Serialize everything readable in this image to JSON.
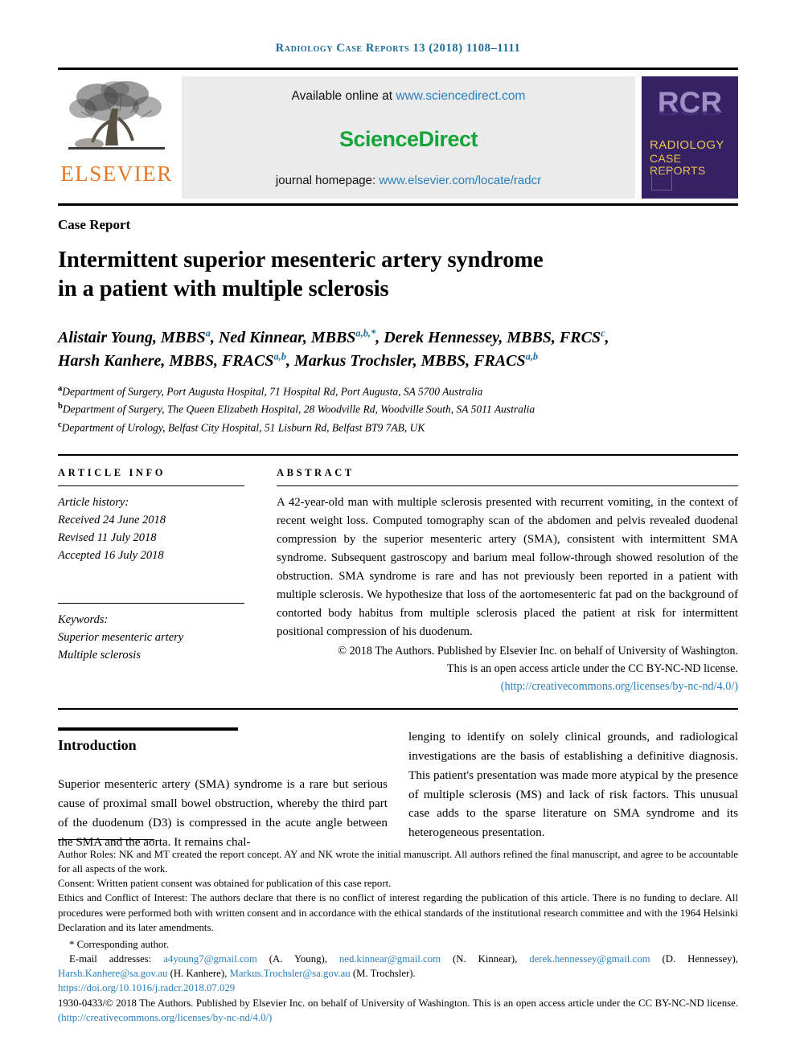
{
  "running_head": {
    "journal": "Radiology Case Reports",
    "volume_year_pages": "13 (2018) 1108–1111"
  },
  "masthead": {
    "elsevier_wordmark": "ELSEVIER",
    "available_online_prefix": "Available online at ",
    "sciencedirect_url": "www.sciencedirect.com",
    "sciencedirect_logo": "ScienceDirect",
    "journal_homepage_prefix": "journal homepage: ",
    "journal_homepage_url": "www.elsevier.com/locate/radcr",
    "cover": {
      "acronym": "RCR",
      "title_line1": "RADIOLOGY",
      "title_line2": "CASE",
      "title_line3": "REPORTS"
    }
  },
  "article": {
    "type_label": "Case Report",
    "title_line1": "Intermittent superior mesenteric artery syndrome",
    "title_line2": "in a patient with multiple sclerosis",
    "authors_line1_a": "Alistair Young, MBBS",
    "authors_line1_a_sup": "a",
    "authors_line1_b": ", Ned Kinnear, MBBS",
    "authors_line1_b_sup": "a,b,*",
    "authors_line1_c": ", Derek Hennessey, MBBS, FRCS",
    "authors_line1_c_sup": "c",
    "authors_line1_tail": ",",
    "authors_line2_a": "Harsh Kanhere, MBBS, FRACS",
    "authors_line2_a_sup": "a,b",
    "authors_line2_b": ", Markus Trochsler, MBBS, FRACS",
    "authors_line2_b_sup": "a,b",
    "affiliations": [
      {
        "marker": "a",
        "text": "Department of Surgery, Port Augusta Hospital, 71 Hospital Rd, Port Augusta, SA 5700 Australia"
      },
      {
        "marker": "b",
        "text": "Department of Surgery, The Queen Elizabeth Hospital, 28 Woodville Rd, Woodville South, SA 5011 Australia"
      },
      {
        "marker": "c",
        "text": "Department of Urology, Belfast City Hospital, 51 Lisburn Rd, Belfast BT9 7AB, UK"
      }
    ]
  },
  "article_info": {
    "label": "ARTICLE INFO",
    "history_label": "Article history:",
    "received": "Received 24 June 2018",
    "revised": "Revised 11 July 2018",
    "accepted": "Accepted 16 July 2018",
    "keywords_label": "Keywords:",
    "keywords": [
      "Superior mesenteric artery",
      "Multiple sclerosis"
    ]
  },
  "abstract": {
    "label": "ABSTRACT",
    "text": "A 42-year-old man with multiple sclerosis presented with recurrent vomiting, in the context of recent weight loss. Computed tomography scan of the abdomen and pelvis revealed duodenal compression by the superior mesenteric artery (SMA), consistent with intermittent SMA syndrome. Subsequent gastroscopy and barium meal follow-through showed resolution of the obstruction. SMA syndrome is rare and has not previously been reported in a patient with multiple sclerosis. We hypothesize that loss of the aortomesenteric fat pad on the background of contorted body habitus from multiple sclerosis placed the patient at risk for intermittent positional compression of his duodenum.",
    "copyright_line1": "© 2018 The Authors. Published by Elsevier Inc. on behalf of University of Washington.",
    "copyright_line2": "This is an open access article under the CC BY-NC-ND license.",
    "license_url": "(http://creativecommons.org/licenses/by-nc-nd/4.0/)"
  },
  "introduction": {
    "heading": "Introduction",
    "left_paragraph": "Superior mesenteric artery (SMA) syndrome is a rare but serious cause of proximal small bowel obstruction, whereby the third part of the duodenum (D3) is compressed in the acute angle between the SMA and the aorta. It remains chal-",
    "right_paragraph": "lenging to identify on solely clinical grounds, and radiological investigations are the basis of establishing a definitive diagnosis. This patient's presentation was made more atypical by the presence of multiple sclerosis (MS) and lack of risk factors. This unusual case adds to the sparse literature on SMA syndrome and its heterogeneous presentation."
  },
  "footnotes": {
    "author_roles": "Author Roles: NK and MT created the report concept. AY and NK wrote the initial manuscript. All authors refined the final manuscript, and agree to be accountable for all aspects of the work.",
    "consent": "Consent: Written patient consent was obtained for publication of this case report.",
    "ethics": "Ethics and Conflict of Interest: The authors declare that there is no conflict of interest regarding the publication of this article. There is no funding to declare. All procedures were performed both with written consent and in accordance with the ethical standards of the institutional research committee and with the 1964 Helsinki Declaration and its later amendments.",
    "corresponding": "* Corresponding author.",
    "emails_label": "E-mail addresses: ",
    "emails": [
      {
        "address": "a4young7@gmail.com",
        "name": " (A. Young), "
      },
      {
        "address": "ned.kinnear@gmail.com",
        "name": " (N. Kinnear), "
      },
      {
        "address": "derek.hennessey@gmail.com",
        "name": " (D. Hennessey), "
      },
      {
        "address": "Harsh.Kanhere@sa.gov.au",
        "name": " (H. Kanhere), "
      },
      {
        "address": "Markus.Trochsler@sa.gov.au",
        "name": " (M. Trochsler)."
      }
    ],
    "doi": "https://doi.org/10.1016/j.radcr.2018.07.029",
    "issn_copyright": "1930-0433/© 2018 The Authors. Published by Elsevier Inc. on behalf of University of Washington. This is an open access article under the CC BY-NC-ND license. ",
    "issn_license_url": "(http://creativecommons.org/licenses/by-nc-nd/4.0/)"
  }
}
